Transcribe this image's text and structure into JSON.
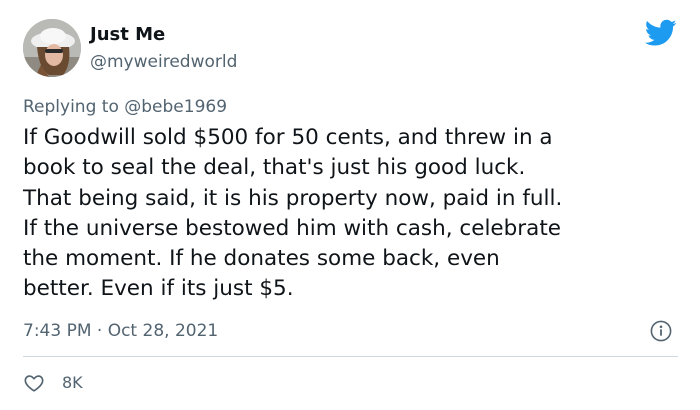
{
  "user": {
    "display_name": "Just Me",
    "handle": "@myweiredworld"
  },
  "reply": {
    "prefix": "Replying to ",
    "mention": "@bebe1969"
  },
  "tweet": {
    "lines": [
      "If Goodwill sold $500 for 50 cents, and threw in a",
      "book to seal the deal, that's just his good luck.",
      "That being said, it is his property now, paid in full.",
      "If the universe bestowed him with cash, celebrate",
      "the moment. If he donates some back, even",
      "better. Even if its just $5."
    ],
    "timestamp": "7:43 PM · Oct 28, 2021",
    "like_count": "8K"
  },
  "icons": {
    "brand": "twitter-bird-icon",
    "info": "info-icon",
    "like": "heart-icon"
  },
  "colors": {
    "brand_blue": "#1d9bf0",
    "text_primary": "#0f1419",
    "text_secondary": "#536471",
    "divider": "#cfd9de"
  }
}
